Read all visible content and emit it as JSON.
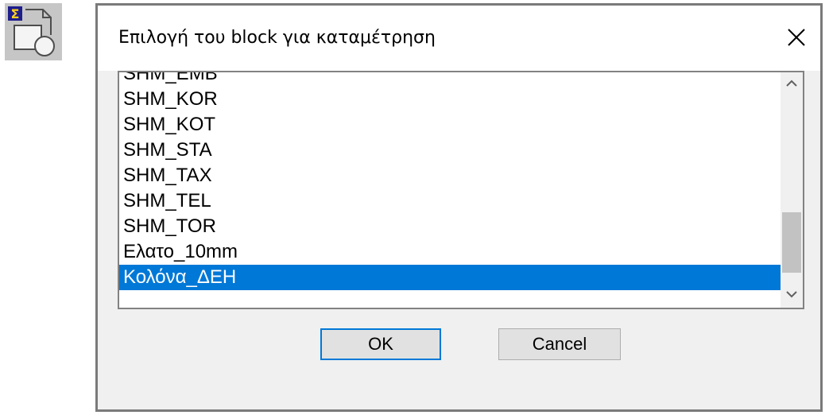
{
  "app_icon": {
    "icon": "block-count-sigma-icon",
    "glyph": "Σ"
  },
  "dialog": {
    "title": "Επιλογή του block για καταμέτρηση",
    "close_icon": "close-icon"
  },
  "list": {
    "items": [
      "SHM_EMB",
      "SHM_KOR",
      "SHM_KOT",
      "SHM_STA",
      "SHM_TAX",
      "SHM_TEL",
      "SHM_TOR",
      "Ελατο_10mm",
      "Κολόνα_ΔΕΗ"
    ],
    "selected_index": 8,
    "scroll_up_icon": "chevron-up-icon",
    "scroll_down_icon": "chevron-down-icon"
  },
  "buttons": {
    "ok_label": "OK",
    "cancel_label": "Cancel"
  },
  "colors": {
    "selection": "#0078d7",
    "default_button_border": "#0078d7",
    "dialog_bg": "#f0f0f0"
  }
}
